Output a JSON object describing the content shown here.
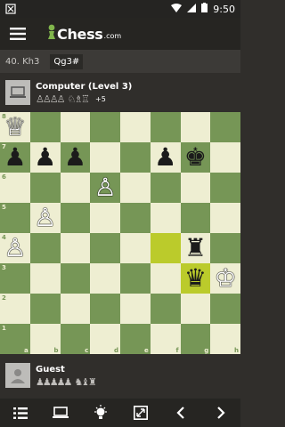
{
  "status_bar": {
    "time": "9:50",
    "icons": [
      "notification-icon",
      "wifi-icon",
      "signal-icon",
      "battery-icon"
    ]
  },
  "header": {
    "logo_text": "Chess",
    "logo_suffix": ".com",
    "icons": [
      "hamburger-menu-icon",
      "pawn-logo-icon"
    ]
  },
  "moves": {
    "previous": "40. Kh3",
    "current": "Qg3#"
  },
  "top_player": {
    "name": "Computer (Level 3)",
    "captured_pawns": "♙♙♙♙",
    "captured_pieces": "♘♗♖",
    "advantage": "+5"
  },
  "bottom_player": {
    "name": "Guest",
    "captured_pawns": "♟♟♟♟♟",
    "captured_pieces": "♞♝♜"
  },
  "board": {
    "files": [
      "a",
      "b",
      "c",
      "d",
      "e",
      "f",
      "g",
      "h"
    ],
    "ranks": [
      "8",
      "7",
      "6",
      "5",
      "4",
      "3",
      "2",
      "1"
    ],
    "highlighted_squares": [
      "f4",
      "g3"
    ],
    "pieces": [
      {
        "square": "a8",
        "type": "queen",
        "color": "white",
        "glyph": "♕"
      },
      {
        "square": "a7",
        "type": "pawn",
        "color": "black",
        "glyph": "♟"
      },
      {
        "square": "b7",
        "type": "pawn",
        "color": "black",
        "glyph": "♟"
      },
      {
        "square": "c7",
        "type": "pawn",
        "color": "black",
        "glyph": "♟"
      },
      {
        "square": "f7",
        "type": "pawn",
        "color": "black",
        "glyph": "♟"
      },
      {
        "square": "g7",
        "type": "king",
        "color": "black",
        "glyph": "♚"
      },
      {
        "square": "d6",
        "type": "pawn",
        "color": "white",
        "glyph": "♙"
      },
      {
        "square": "b5",
        "type": "pawn",
        "color": "white",
        "glyph": "♙"
      },
      {
        "square": "a4",
        "type": "pawn",
        "color": "white",
        "glyph": "♙"
      },
      {
        "square": "g4",
        "type": "rook",
        "color": "black",
        "glyph": "♜"
      },
      {
        "square": "g3",
        "type": "queen",
        "color": "black",
        "glyph": "♛"
      },
      {
        "square": "h3",
        "type": "king",
        "color": "white",
        "glyph": "♔"
      }
    ]
  },
  "colors": {
    "light_square": "#eeeed2",
    "dark_square": "#769656",
    "highlight": "#bbcb2b",
    "background": "#302e2b"
  },
  "bottom_nav": {
    "icons": [
      "move-list-icon",
      "computer-icon",
      "hint-bulb-icon",
      "flip-board-icon",
      "back-arrow-icon",
      "forward-arrow-icon"
    ]
  }
}
